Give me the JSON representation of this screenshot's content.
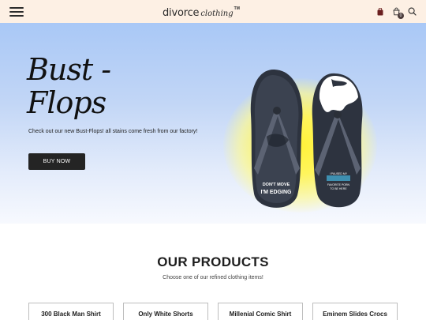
{
  "header": {
    "logo_main": "divorce",
    "logo_sub": "clothing",
    "logo_tm": "TM",
    "cart_count": "0",
    "icons": [
      "menu-icon",
      "bag-icon",
      "cart-icon",
      "search-icon"
    ]
  },
  "hero": {
    "title": "Bust - Flops",
    "text": "Check out our new Bust-Flops! all stains come fresh from our factory!",
    "button": "BUY NOW",
    "flop_left_text": "DON'T MOVE I'M EDGING",
    "flop_right_text": "I PAUSED MY FAVORITE PORN TO BE HERE",
    "colors": {
      "flop_base": "#2e3440",
      "strap": "#5a6170",
      "glow": "#fff23a",
      "sky_top": "#a9c8f6"
    }
  },
  "products": {
    "title": "OUR PRODUCTS",
    "subtitle": "Choose one of our refined clothing items!",
    "categories": [
      "300 Black Man Shirt",
      "Only White Shorts",
      "Millenial Comic Shirt",
      "Eminem Slides Crocs"
    ]
  }
}
